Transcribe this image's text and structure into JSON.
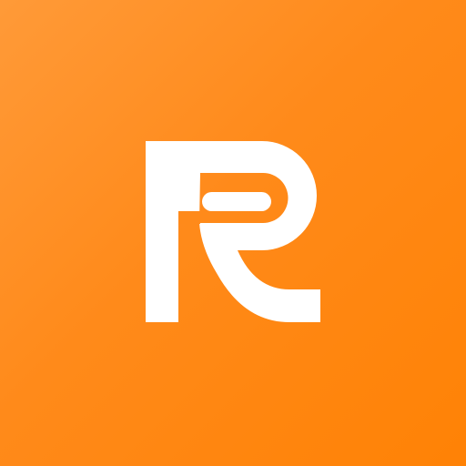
{
  "app_icon": {
    "logo_icon": "r-monogram-icon",
    "colors": {
      "background_start": "#FF9A38",
      "background_end": "#FF8205",
      "logo": "#FFFFFF"
    }
  }
}
